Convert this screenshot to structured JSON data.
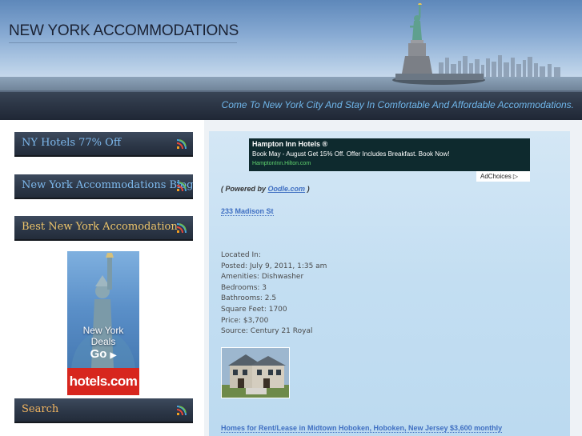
{
  "header": {
    "site_title": "NEW YORK ACCOMMODATIONS",
    "tagline": "Come To New York City And Stay In Comfortable And Affordable Accommodations."
  },
  "sidebar": {
    "items": [
      {
        "label": "NY Hotels 77% Off",
        "icon": "rss-icon"
      },
      {
        "label": "New York Accommodations Blog",
        "icon": "rss-icon"
      },
      {
        "label": "Best New York Accomodation",
        "icon": "rss-icon"
      },
      {
        "label": "Search",
        "icon": "rss-icon"
      }
    ],
    "ad": {
      "line1": "New York",
      "line2": "Deals",
      "cta": "Go",
      "brand": "hotels.com"
    }
  },
  "content": {
    "sponsored": {
      "title": "Hampton Inn Hotels ®",
      "description": "Book May - August Get 15% Off. Offer Includes Breakfast. Book Now!",
      "url": "HamptonInn.Hilton.com",
      "adchoices": "AdChoices"
    },
    "powered_prefix": "( Powered by",
    "powered_link": "Oodle.com",
    "powered_suffix": ")",
    "listing_title": "233 Madison St",
    "details": [
      "Located In:",
      "Posted: July 9, 2011, 1:35 am",
      "Amenities: Dishwasher",
      "Bedrooms: 3",
      "Bathrooms: 2.5",
      "Square Feet: 1700",
      "Price: $3,700",
      "Source: Century 21 Royal"
    ],
    "next_listing_title": "Homes for Rent/Lease in Midtown Hoboken, Hoboken, New Jersey $3,600 monthly"
  },
  "colors": {
    "title": "#1b2233",
    "tagline": "#6fb6ea",
    "sidebar_button": "#2b3646",
    "link": "#3f6fc2",
    "content_bg": "#c3def2"
  }
}
